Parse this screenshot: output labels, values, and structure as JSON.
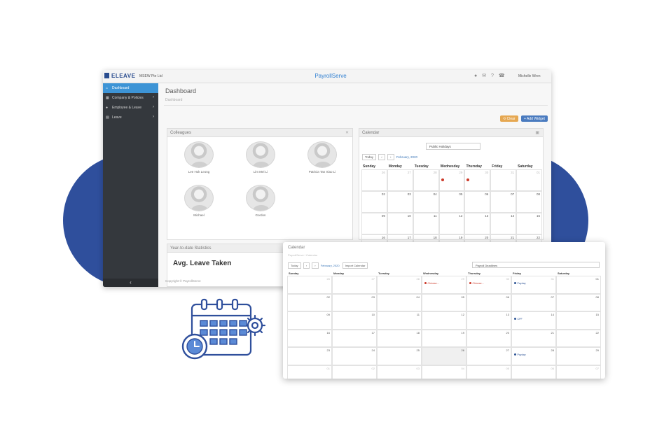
{
  "colors": {
    "accent": "#2f4f9c",
    "sidebar": "#34383d",
    "active": "#3d94d6",
    "holiday_dot": "#cc3a2a",
    "payday": "#2f5596"
  },
  "topbar": {
    "brand": "ELEAVE",
    "company": "MSEW Pte Ltd",
    "app_title": "PayrollServe",
    "user": "Michelle Wren"
  },
  "sidebar": {
    "items": [
      {
        "label": "Dashboard",
        "icon": "home-icon",
        "active": true
      },
      {
        "label": "Company & Policies",
        "icon": "building-icon",
        "active": false
      },
      {
        "label": "Employee & Leave",
        "icon": "user-icon",
        "active": false
      },
      {
        "label": "Leave",
        "icon": "calendar-icon",
        "active": false
      }
    ],
    "collapse": "‹"
  },
  "header": {
    "title": "Dashboard",
    "breadcrumb": "Dashboard"
  },
  "buttons": {
    "clear": "Clear",
    "add_widget": "Add Widget"
  },
  "colleagues": {
    "title": "Colleagues",
    "people": [
      "Lee Hok Leong",
      "Lim Mei Li",
      "Patricia Tan Xiao Li",
      "Michael",
      "Gordon"
    ]
  },
  "calendar_widget": {
    "title": "Calendar",
    "select": "Public Holidays",
    "today": "Today",
    "month": "February, 2020",
    "weekdays": [
      "Sunday",
      "Monday",
      "Tuesday",
      "Wednesday",
      "Thursday",
      "Friday",
      "Saturday"
    ],
    "weeks": [
      [
        "26",
        "27",
        "28",
        "29",
        "30",
        "31",
        "01"
      ],
      [
        "02",
        "03",
        "04",
        "05",
        "06",
        "07",
        "08"
      ],
      [
        "09",
        "10",
        "11",
        "12",
        "13",
        "14",
        "15"
      ],
      [
        "16",
        "17",
        "18",
        "19",
        "20",
        "21",
        "22"
      ]
    ]
  },
  "stats": {
    "title": "Year-to-date Statistics",
    "metric": "Avg. Leave Taken"
  },
  "footer": {
    "copyright": "Copyright © PayrollServe"
  },
  "calendar_page": {
    "title": "Calendar",
    "breadcrumb": "PayrollServe / Calendar",
    "today": "Today",
    "month": "February, 2020",
    "import": "Import Calendar",
    "select": "Payroll Deadlines",
    "weekdays": [
      "Sunday",
      "Monday",
      "Tuesday",
      "Wednesday",
      "Thursday",
      "Friday",
      "Saturday"
    ],
    "weeks": [
      [
        "26",
        "27",
        "28",
        "29",
        "30",
        "31",
        "01"
      ],
      [
        "02",
        "03",
        "04",
        "05",
        "06",
        "07",
        "08"
      ],
      [
        "09",
        "10",
        "11",
        "12",
        "13",
        "14",
        "15"
      ],
      [
        "16",
        "17",
        "18",
        "19",
        "20",
        "21",
        "22"
      ],
      [
        "23",
        "24",
        "25",
        "26",
        "27",
        "28",
        "29"
      ],
      [
        "01",
        "02",
        "03",
        "04",
        "05",
        "06",
        "07"
      ]
    ],
    "events": {
      "holiday": "Chinese...",
      "payday": "Payday",
      "cpf": "CPF"
    }
  }
}
